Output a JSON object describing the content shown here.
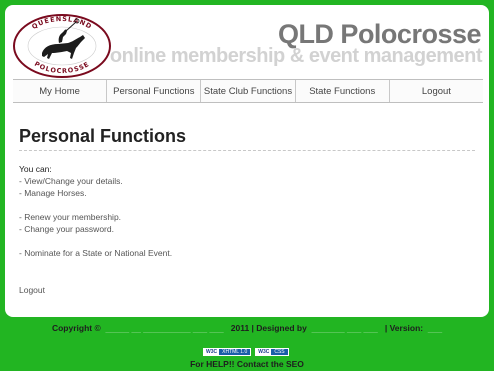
{
  "header": {
    "logo_text_top": "QUEENSLAND",
    "logo_text_bottom": "POLOCROSSE",
    "title": "QLD Polocrosse",
    "subtitle": "online membership & event management"
  },
  "nav": {
    "items": [
      {
        "label": "My Home"
      },
      {
        "label": "Personal Functions"
      },
      {
        "label": "State Club Functions"
      },
      {
        "label": "State Functions"
      },
      {
        "label": "Logout"
      }
    ]
  },
  "main": {
    "heading": "Personal Functions",
    "intro": "You can:",
    "groups": [
      [
        "- View/Change your details.",
        "- Manage Horses."
      ],
      [
        "- Renew your membership.",
        "- Change your password."
      ],
      [
        "- Nominate for a State or National Event."
      ]
    ],
    "logout_label": "Logout"
  },
  "footer": {
    "copyright_prefix": "Copyright ©",
    "year_text": "2011 | Designed by",
    "version_label": "| Version:",
    "help_text": "For HELP!! Contact the SEO",
    "badge_html": {
      "left": "W3C",
      "right": "XHTML 1.0"
    },
    "badge_css": {
      "left": "W3C",
      "right": "CSS"
    }
  },
  "colors": {
    "background": "#22b522",
    "title": "#777777",
    "subtitle": "#d2d2d2",
    "link_faint": "#7fd07f"
  }
}
